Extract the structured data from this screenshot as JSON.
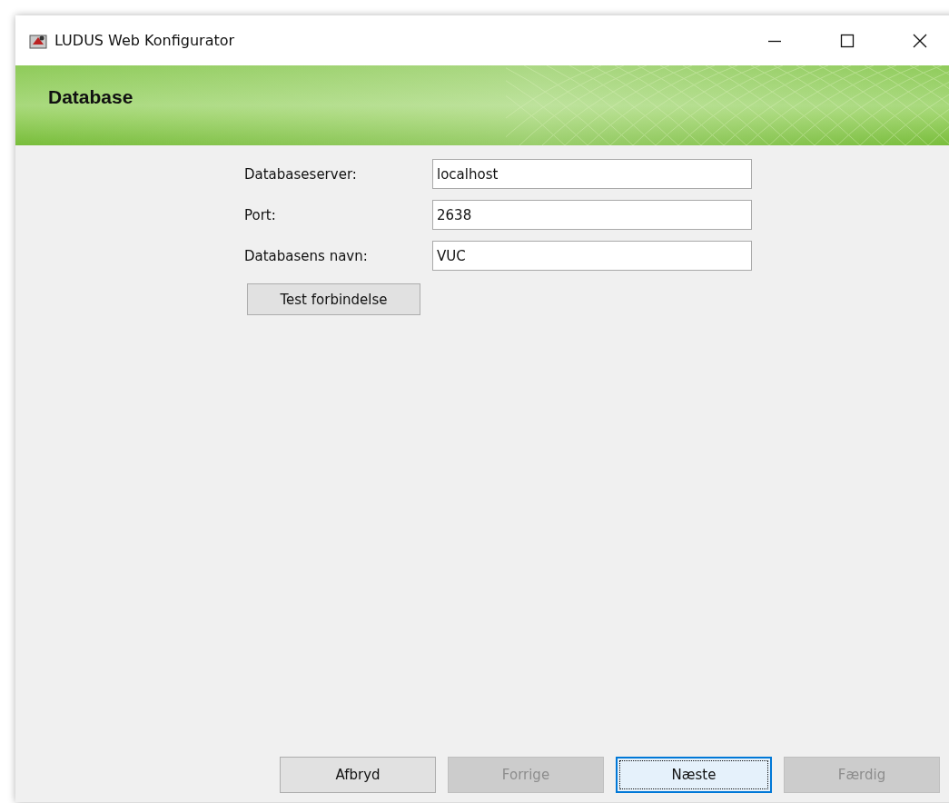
{
  "window": {
    "title": "LUDUS Web Konfigurator"
  },
  "header": {
    "title": "Database"
  },
  "fields": [
    {
      "label": "Databaseserver:",
      "value": "localhost"
    },
    {
      "label": "Port:",
      "value": "2638"
    },
    {
      "label": "Databasens navn:",
      "value": "VUC"
    }
  ],
  "test_button": {
    "label": "Test forbindelse"
  },
  "buttons": [
    {
      "label": "Afbryd",
      "disabled": false,
      "focused": false
    },
    {
      "label": "Forrige",
      "disabled": true,
      "focused": false
    },
    {
      "label": "Næste",
      "disabled": false,
      "focused": true
    },
    {
      "label": "Færdig",
      "disabled": true,
      "focused": false
    }
  ]
}
